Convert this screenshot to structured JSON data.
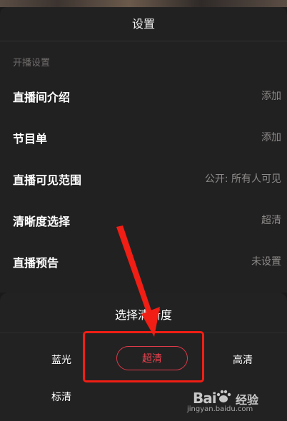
{
  "header": {
    "title": "设置"
  },
  "section": {
    "label": "开播设置"
  },
  "rows": [
    {
      "label": "直播间介绍",
      "value": "添加"
    },
    {
      "label": "节目单",
      "value": "添加"
    },
    {
      "label": "直播可见范围",
      "value": "公开: 所有人可见"
    },
    {
      "label": "清晰度选择",
      "value": "超清"
    },
    {
      "label": "直播预告",
      "value": "未设置"
    }
  ],
  "quality_sheet": {
    "title": "选择清晰度",
    "options": [
      "蓝光",
      "超清",
      "高清",
      "标清"
    ],
    "selected": "超清",
    "accent_color": "#e0394a"
  },
  "annotation": {
    "color": "#f01e14",
    "icon": "red-arrow-icon"
  },
  "watermark": {
    "brand": "Bai",
    "brand_suffix": "经验",
    "url": "jingyan.baidu.com"
  }
}
